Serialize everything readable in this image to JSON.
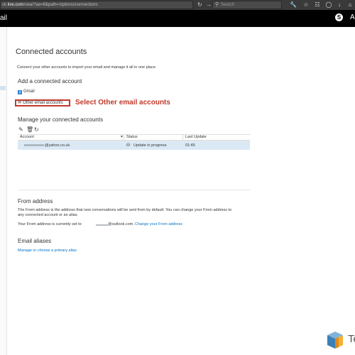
{
  "browser": {
    "url_prefix": "ck.",
    "url_domain": "live.com",
    "url_path": "/owa/?ae=8&path=/options/connections",
    "search_placeholder": "Search"
  },
  "app": {
    "title": "ail",
    "user_initial": "A",
    "skype_glyph": "S"
  },
  "page": {
    "title": "Connected accounts",
    "intro": "Connect your other accounts to import your email and manage it all in one place."
  },
  "add_section": {
    "heading": "Add a connected account",
    "gmail_label": "Gmail",
    "gmail_icon_glyph": "g",
    "other_label": "Other email accounts",
    "annotation": "Select Other email accounts",
    "annotation_color": "#c0392b"
  },
  "manage_section": {
    "heading": "Manage your connected accounts",
    "toolbar_icons": [
      "edit-icon",
      "delete-icon",
      "refresh-icon"
    ],
    "columns": [
      "Account",
      "Status",
      "Last Update"
    ],
    "rows": [
      {
        "account": "@yahoo.co.uk",
        "status": "Update in progress",
        "last_update": "01:45"
      }
    ]
  },
  "from_section": {
    "heading": "From address",
    "desc_line1": "The From address is the address that new conversations will be sent from by default. You can change your From address to",
    "desc_line2": "any connected account or an alias.",
    "current_prefix": "Your From address is currently set to",
    "current_address": "@outlook.com.",
    "change_link": "Change your From address"
  },
  "aliases_section": {
    "heading": "Email aliases",
    "manage_link": "Manage or choose a primary alias"
  },
  "logo": {
    "text": "Te"
  },
  "colors": {
    "link": "#0072c6",
    "header_bg": "#000000",
    "selected_row": "#dbe9f5"
  }
}
